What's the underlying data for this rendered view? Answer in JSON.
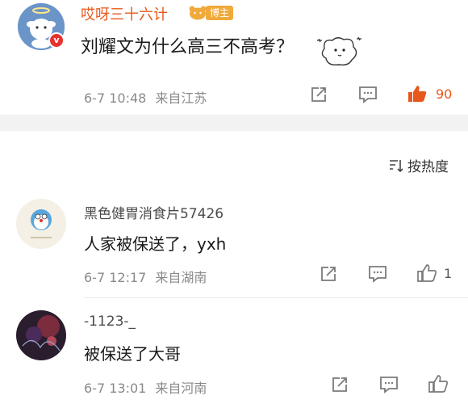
{
  "post": {
    "username": "哎呀三十六计",
    "host_badge": "博主",
    "verified_icon": "v-badge-icon",
    "content": "刘耀文为什么高三不高考？",
    "time": "6-7 10:48",
    "location": "来自江苏",
    "likes": "90",
    "accent_color": "#e7581d"
  },
  "sort": {
    "label": "按热度"
  },
  "comments": [
    {
      "name": "黑色健胃消食片57426",
      "text": "人家被保送了，yxh",
      "time": "6-7 12:17",
      "location": "来自湖南",
      "likes": "1"
    },
    {
      "name": "-1123-_",
      "text": "被保送了大哥",
      "time": "6-7 13:01",
      "location": "来自河南",
      "likes": ""
    }
  ],
  "icons": {
    "share": "share-icon",
    "comment": "comment-icon",
    "like": "thumbs-up-icon",
    "sort": "sort-icon"
  }
}
